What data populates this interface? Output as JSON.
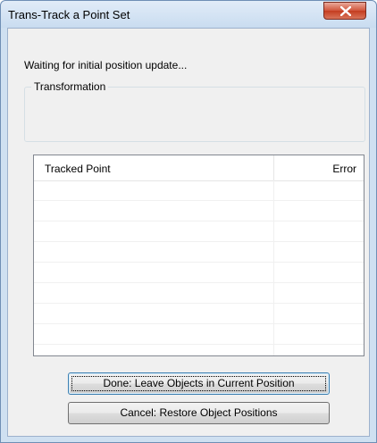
{
  "window": {
    "title": "Trans-Track a Point Set"
  },
  "status": {
    "text": "Waiting for initial position update..."
  },
  "transformation": {
    "label": "Transformation"
  },
  "table": {
    "columns": [
      "Tracked Point",
      "Error"
    ],
    "rows": [
      [
        "",
        ""
      ],
      [
        "",
        ""
      ],
      [
        "",
        ""
      ],
      [
        "",
        ""
      ],
      [
        "",
        ""
      ],
      [
        "",
        ""
      ],
      [
        "",
        ""
      ],
      [
        "",
        ""
      ]
    ]
  },
  "buttons": {
    "done": "Done: Leave Objects in Current Position",
    "cancel": "Cancel: Restore Object Positions"
  },
  "icons": {
    "close": "close-icon"
  }
}
